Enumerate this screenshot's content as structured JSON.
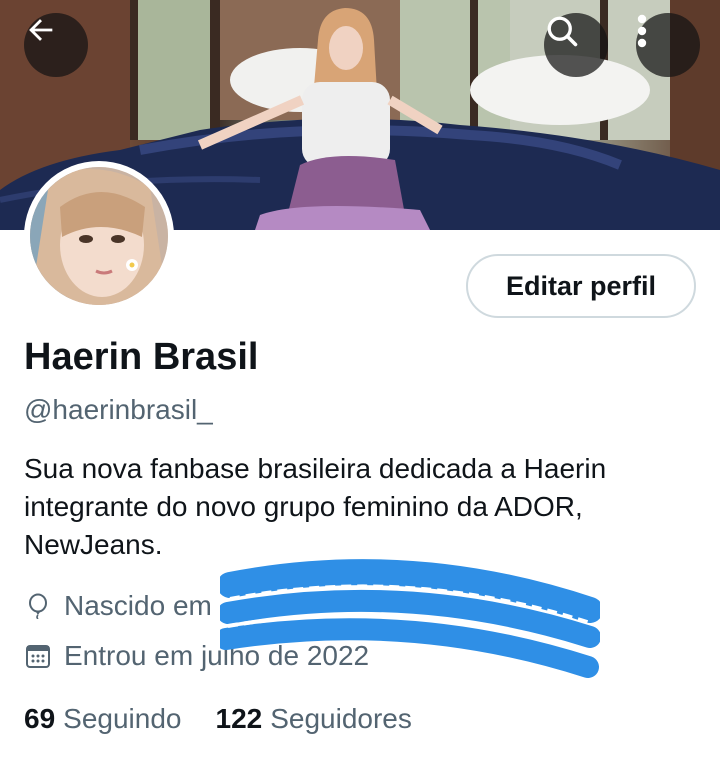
{
  "header": {
    "back_icon": "arrow-left-icon",
    "search_icon": "search-icon",
    "more_icon": "more-vertical-icon"
  },
  "profile": {
    "name": "Haerin Brasil",
    "handle": "@haerinbrasil_",
    "bio": "Sua nova fanbase brasileira dedicada a Haerin integrante do novo grupo feminino da ADOR, NewJeans.",
    "edit_button_label": "Editar perfil",
    "born_label": "Nascido em",
    "joined_label": "Entrou em julho de 2022"
  },
  "stats": {
    "following_count": "69",
    "following_label": "Seguindo",
    "followers_count": "122",
    "followers_label": "Seguidores"
  },
  "colors": {
    "text_primary": "#0f1419",
    "text_secondary": "#536471",
    "border": "#cfd9de",
    "redaction_blue": "#2f8fe6"
  }
}
